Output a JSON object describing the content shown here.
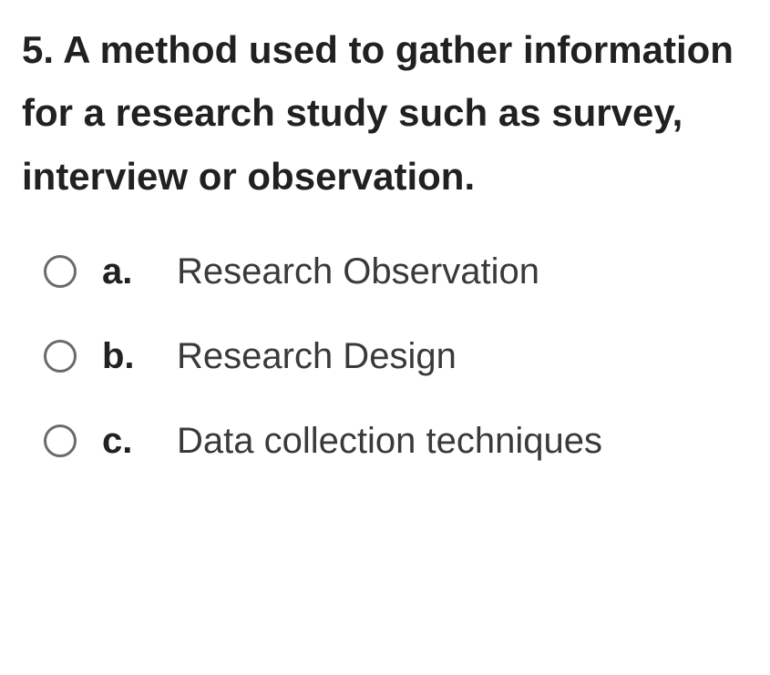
{
  "question": {
    "number": "5.",
    "text": "5. A method used to gather information for a research study such as survey, interview or observation."
  },
  "options": [
    {
      "letter": "a.",
      "text": "Research Observation"
    },
    {
      "letter": "b.",
      "text": "Research Design"
    },
    {
      "letter": "c.",
      "text": "Data collection techniques"
    }
  ]
}
